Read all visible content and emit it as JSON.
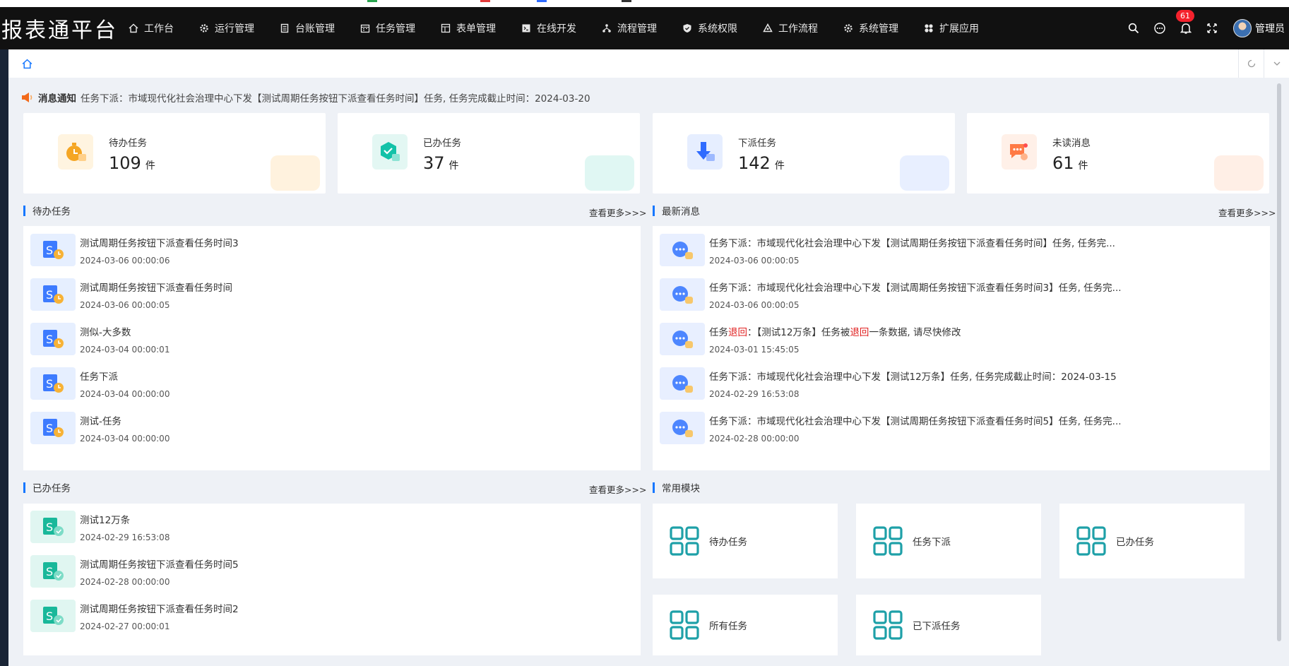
{
  "app": {
    "brand": "报表通平台"
  },
  "nav": [
    {
      "label": "工作台",
      "icon": "home-icon"
    },
    {
      "label": "运行管理",
      "icon": "gear-icon"
    },
    {
      "label": "台账管理",
      "icon": "book-icon"
    },
    {
      "label": "任务管理",
      "icon": "calendar-icon"
    },
    {
      "label": "表单管理",
      "icon": "form-icon"
    },
    {
      "label": "在线开发",
      "icon": "terminal-icon"
    },
    {
      "label": "流程管理",
      "icon": "flow-icon"
    },
    {
      "label": "系统权限",
      "icon": "shield-icon"
    },
    {
      "label": "工作流程",
      "icon": "recycle-icon"
    },
    {
      "label": "系统管理",
      "icon": "gear-icon"
    },
    {
      "label": "扩展应用",
      "icon": "apps-icon"
    }
  ],
  "header": {
    "badge_count": "61",
    "user_name": "管理员"
  },
  "notice": {
    "label": "消息通知",
    "text": "任务下派：市域现代化社会治理中心下发【测试周期任务按钮下派查看任务时间】任务, 任务完成截止时间：2024-03-20"
  },
  "stats": [
    {
      "title": "待办任务",
      "value": "109",
      "unit": "件",
      "color": "#f5a623"
    },
    {
      "title": "已办任务",
      "value": "37",
      "unit": "件",
      "color": "#13c2a8"
    },
    {
      "title": "下派任务",
      "value": "142",
      "unit": "件",
      "color": "#2f6bff"
    },
    {
      "title": "未读消息",
      "value": "61",
      "unit": "件",
      "color": "#ff7a45"
    }
  ],
  "todo": {
    "title": "待办任务",
    "more": "查看更多>>>",
    "items": [
      {
        "title": "测试周期任务按钮下派查看任务时间3",
        "time": "2024-03-06 00:00:06"
      },
      {
        "title": "测试周期任务按钮下派查看任务时间",
        "time": "2024-03-06 00:00:05"
      },
      {
        "title": "测似-大多数",
        "time": "2024-03-04 00:00:01"
      },
      {
        "title": "任务下派",
        "time": "2024-03-04 00:00:00"
      },
      {
        "title": "测试-任务",
        "time": "2024-03-04 00:00:00"
      }
    ]
  },
  "messages": {
    "title": "最新消息",
    "more": "查看更多>>>",
    "items": [
      {
        "title": "任务下派：市域现代化社会治理中心下发【测试周期任务按钮下派查看任务时间】任务, 任务完...",
        "time": "2024-03-06 00:00:05"
      },
      {
        "title": "任务下派：市域现代化社会治理中心下发【测试周期任务按钮下派查看任务时间3】任务, 任务完...",
        "time": "2024-03-06 00:00:05"
      },
      {
        "title_parts": [
          "任务",
          "退回",
          "：【测试12万条】任务被",
          "退回",
          "一条数据, 请尽快修改"
        ],
        "time": "2024-03-01 15:45:05"
      },
      {
        "title": "任务下派：市域现代化社会治理中心下发【测试12万条】任务, 任务完成截止时间：2024-03-15",
        "time": "2024-02-29 16:53:08"
      },
      {
        "title": "任务下派：市域现代化社会治理中心下发【测试周期任务按钮下派查看任务时间5】任务, 任务完...",
        "time": "2024-02-28 00:00:00"
      }
    ]
  },
  "done": {
    "title": "已办任务",
    "more": "查看更多>>>",
    "items": [
      {
        "title": "测试12万条",
        "time": "2024-02-29 16:53:08"
      },
      {
        "title": "测试周期任务按钮下派查看任务时间5",
        "time": "2024-02-28 00:00:00"
      },
      {
        "title": "测试周期任务按钮下派查看任务时间2",
        "time": "2024-02-27 00:00:01"
      }
    ]
  },
  "modules": {
    "title": "常用模块",
    "items": [
      {
        "label": "待办任务"
      },
      {
        "label": "任务下派"
      },
      {
        "label": "已办任务"
      },
      {
        "label": "所有任务"
      },
      {
        "label": "已下派任务"
      }
    ]
  },
  "colors": {
    "accent": "#1677ff",
    "header_bg": "#111111",
    "module_icon": "#1ea0a8",
    "badge": "#f5222d"
  }
}
